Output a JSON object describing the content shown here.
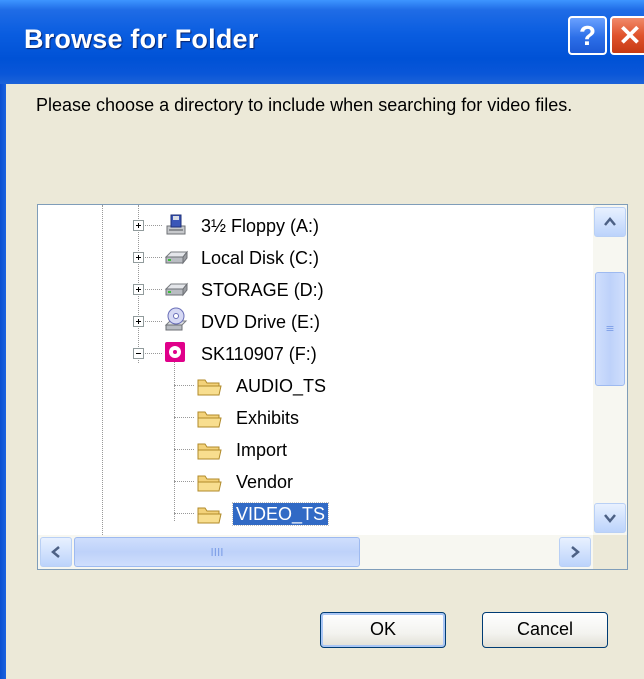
{
  "window": {
    "title": "Browse for Folder",
    "help_label": "?",
    "close_label": "✕"
  },
  "instruction": "Please choose a directory to include when searching for video files.",
  "tree": {
    "items": [
      {
        "label": "3½ Floppy (A:)",
        "icon": "floppy-drive-icon",
        "expanded": false
      },
      {
        "label": "Local Disk (C:)",
        "icon": "hard-disk-icon",
        "expanded": false
      },
      {
        "label": "STORAGE (D:)",
        "icon": "hard-disk-icon",
        "expanded": false
      },
      {
        "label": "DVD Drive (E:)",
        "icon": "dvd-drive-icon",
        "expanded": false
      },
      {
        "label": "SK110907 (F:)",
        "icon": "dvd-disc-icon",
        "expanded": true,
        "children": [
          {
            "label": "AUDIO_TS",
            "icon": "folder-icon"
          },
          {
            "label": "Exhibits",
            "icon": "folder-icon"
          },
          {
            "label": "Import",
            "icon": "folder-icon"
          },
          {
            "label": "Vendor",
            "icon": "folder-icon"
          },
          {
            "label": "VIDEO_TS",
            "icon": "folder-icon",
            "selected": true
          }
        ]
      }
    ],
    "hscroll_grip": "IIII",
    "vscroll_grip": "≡"
  },
  "buttons": {
    "ok": "OK",
    "cancel": "Cancel"
  },
  "colors": {
    "titlebar": "#0a5de0",
    "selection": "#316ac5",
    "dialog_bg": "#ece9d8"
  }
}
